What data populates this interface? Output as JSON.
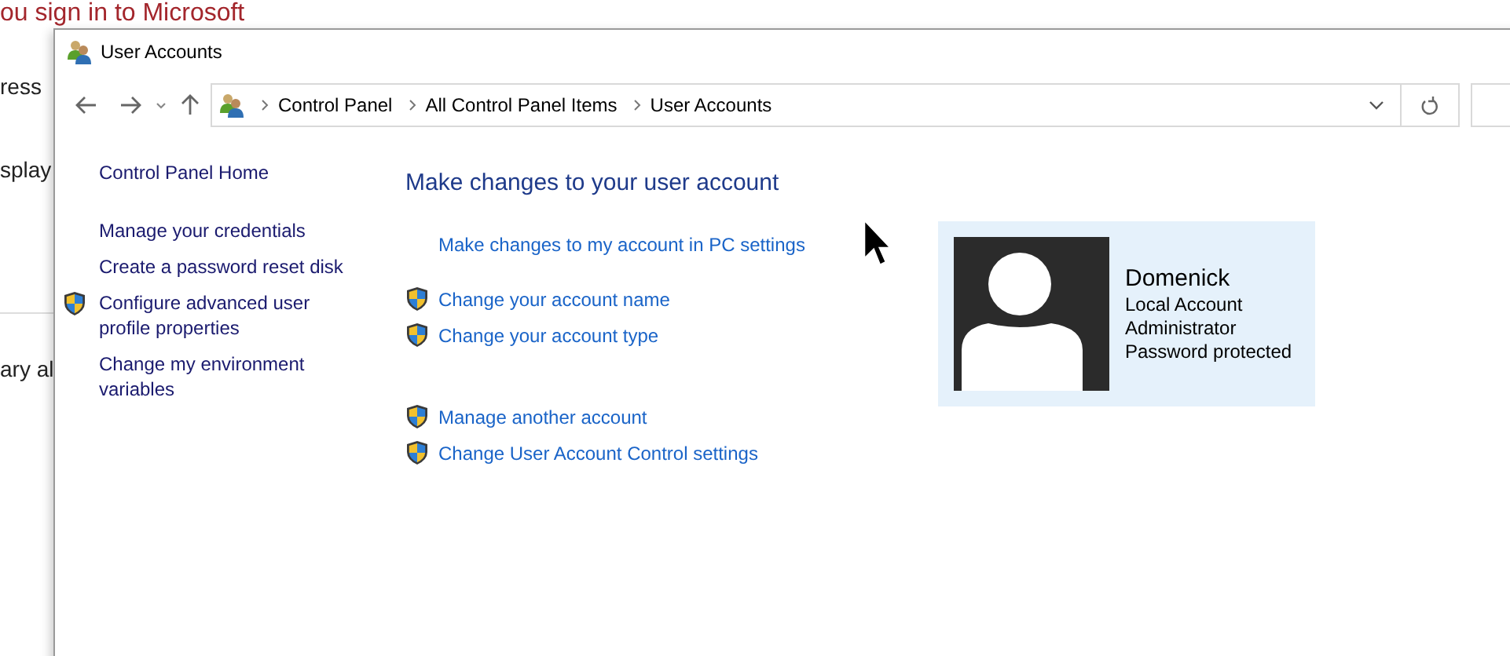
{
  "background_page": {
    "heading": "ou sign in to Microsoft",
    "text_fragments": [
      "ress",
      "splay",
      "ary al"
    ]
  },
  "window": {
    "title": "User Accounts"
  },
  "address_bar": {
    "breadcrumbs": [
      "Control Panel",
      "All Control Panel Items",
      "User Accounts"
    ]
  },
  "sidebar": {
    "home_link": "Control Panel Home",
    "links": [
      {
        "label": "Manage your credentials",
        "shield": false
      },
      {
        "label": "Create a password reset disk",
        "shield": false
      },
      {
        "label": "Configure advanced user profile properties",
        "shield": true
      },
      {
        "label": "Change my environment variables",
        "shield": false
      }
    ]
  },
  "main": {
    "heading": "Make changes to your user account",
    "link_groups": [
      [
        {
          "label": "Make changes to my account in PC settings",
          "shield": false
        }
      ],
      [
        {
          "label": "Change your account name",
          "shield": true
        },
        {
          "label": "Change your account type",
          "shield": true
        }
      ],
      [
        {
          "label": "Manage another account",
          "shield": true
        },
        {
          "label": "Change User Account Control settings",
          "shield": true
        }
      ]
    ]
  },
  "account": {
    "name": "Domenick",
    "details": [
      "Local Account",
      "Administrator",
      "Password protected"
    ]
  }
}
